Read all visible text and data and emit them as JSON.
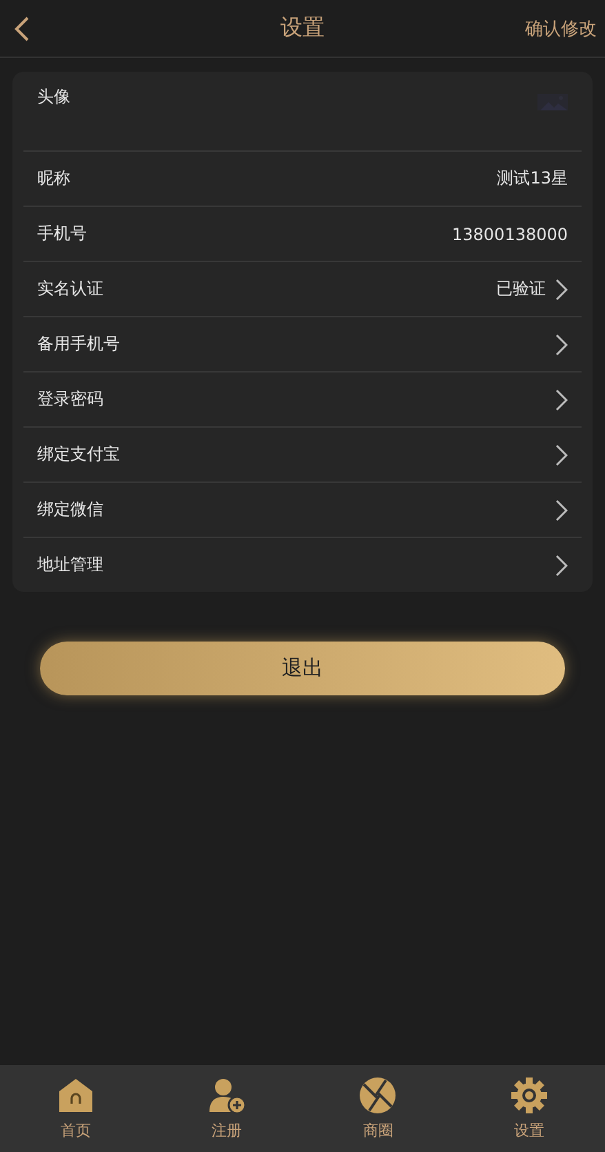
{
  "header": {
    "title": "设置",
    "action": "确认修改"
  },
  "rows": [
    {
      "kind": "avatar",
      "label": "头像"
    },
    {
      "kind": "text",
      "label": "昵称",
      "value": "测试13星"
    },
    {
      "kind": "text",
      "label": "手机号",
      "value": "13800138000"
    },
    {
      "kind": "link",
      "label": "实名认证",
      "value": "已验证"
    },
    {
      "kind": "link",
      "label": "备用手机号"
    },
    {
      "kind": "link",
      "label": "登录密码"
    },
    {
      "kind": "link",
      "label": "绑定支付宝"
    },
    {
      "kind": "link",
      "label": "绑定微信"
    },
    {
      "kind": "link",
      "label": "地址管理"
    }
  ],
  "logout": "退出",
  "tabs": [
    {
      "kind": "home",
      "label": "首页"
    },
    {
      "kind": "user",
      "label": "注册"
    },
    {
      "kind": "circle",
      "label": "商圈"
    },
    {
      "kind": "gear",
      "label": "设置"
    }
  ]
}
